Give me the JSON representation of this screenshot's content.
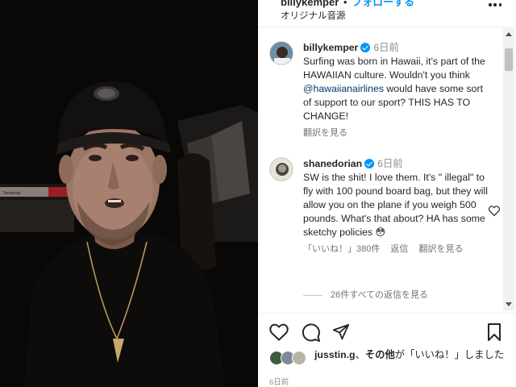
{
  "header": {
    "username": "billykemper",
    "separator": "•",
    "follow_label": "フォローする",
    "subtitle": "オリジナル音源"
  },
  "video": {
    "sign_text": "Terminals"
  },
  "comments": [
    {
      "username": "billykemper",
      "verified": true,
      "time": "6日前",
      "text_before": "Surfing was born in Hawaii, it's part of the HAWAIIAN culture. Wouldn't you think ",
      "mention": "@hawaiianairlines",
      "text_after": " would have some sort of support to our sport? THIS HAS TO CHANGE!",
      "translate_label": "翻訳を見る"
    },
    {
      "username": "shanedorian",
      "verified": true,
      "time": "6日前",
      "text": "SW is the shit! I love them. It's \" illegal\" to fly with 100 pound board bag, but they will allow you on the plane if you weigh 500 pounds. What's that about? HA has some sketchy policies 😳",
      "likes_label": "「いいね！」380件",
      "reply_label": "返信",
      "translate_label": "翻訳を見る",
      "view_replies_label": "26件すべての返信を見る"
    }
  ],
  "likes": {
    "user": "jusstin.g",
    "connector": "、",
    "others": "その他",
    "suffix": "が「いいね！」しました"
  },
  "post_date": "6日前",
  "colors": {
    "accent": "#0095f6",
    "mention": "#00376b",
    "text": "#262626",
    "muted": "#737373"
  },
  "icons": [
    "more-icon",
    "heart-icon",
    "comment-icon",
    "share-icon",
    "bookmark-icon",
    "verified-icon"
  ]
}
